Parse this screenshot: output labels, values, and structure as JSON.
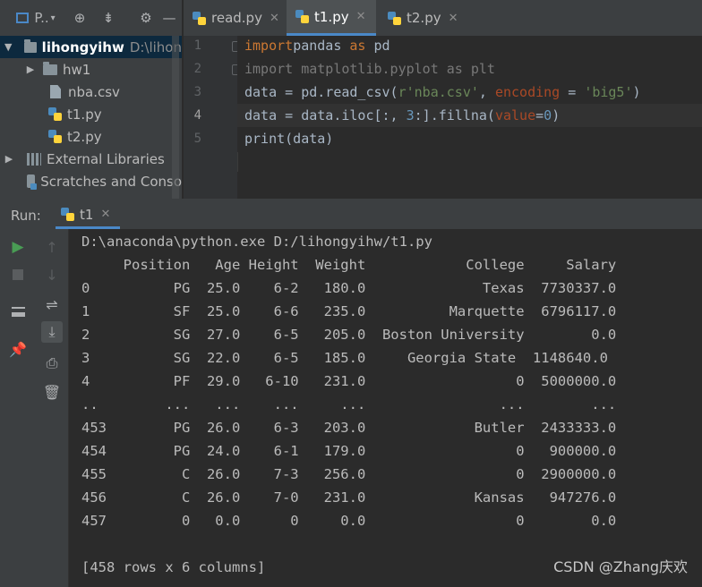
{
  "project_toolbar": {
    "view_label": "P..",
    "icons": [
      "crosshair-icon",
      "collapse-icon",
      "gear-icon",
      "hide-icon"
    ]
  },
  "project_tree": [
    {
      "name": "lihongyihw",
      "path": "D:\\lihon",
      "type": "folder",
      "expanded": true
    },
    {
      "name": "hw1",
      "type": "folder",
      "expanded": false
    },
    {
      "name": "nba.csv",
      "type": "csv"
    },
    {
      "name": "t1.py",
      "type": "py"
    },
    {
      "name": "t2.py",
      "type": "py"
    },
    {
      "name": "External Libraries",
      "type": "lib"
    },
    {
      "name": "Scratches and Conso",
      "type": "scratch"
    }
  ],
  "editor_tabs": [
    {
      "label": "read.py",
      "active": false
    },
    {
      "label": "t1.py",
      "active": true
    },
    {
      "label": "t2.py",
      "active": false
    }
  ],
  "code_lines": [
    {
      "num": "1",
      "tokens": [
        [
          "kw",
          "import"
        ],
        [
          "",
          "pandas "
        ],
        [
          "kw",
          "as"
        ],
        [
          "",
          " pd"
        ]
      ]
    },
    {
      "num": "2",
      "tokens": [
        [
          "dim",
          "import matplotlib.pyplot as plt"
        ]
      ]
    },
    {
      "num": "3",
      "tokens": [
        [
          "",
          "data = pd.read_csv("
        ],
        [
          "str",
          "r'nba.csv'"
        ],
        [
          "",
          ", "
        ],
        [
          "param",
          "encoding"
        ],
        [
          "",
          " = "
        ],
        [
          "str",
          "'big5'"
        ],
        [
          "",
          ")"
        ]
      ]
    },
    {
      "num": "4",
      "tokens": [
        [
          "",
          "data = data.iloc[:, "
        ],
        [
          "num",
          "3"
        ],
        [
          "",
          ":].fillna("
        ],
        [
          "param",
          "value"
        ],
        [
          "",
          "="
        ],
        [
          "num",
          "0"
        ],
        [
          "",
          ")"
        ]
      ]
    },
    {
      "num": "5",
      "tokens": [
        [
          "",
          "print(data)"
        ]
      ]
    }
  ],
  "run_panel": {
    "label": "Run:",
    "tab": "t1",
    "console_lines": [
      "D:\\anaconda\\python.exe D:/lihongyihw/t1.py",
      "     Position   Age Height  Weight            College     Salary",
      "0          PG  25.0    6-2   180.0              Texas  7730337.0",
      "1          SF  25.0    6-6   235.0          Marquette  6796117.0",
      "2          SG  27.0    6-5   205.0  Boston University        0.0",
      "3          SG  22.0    6-5   185.0     Georgia State  1148640.0",
      "4          PF  29.0   6-10   231.0                  0  5000000.0",
      "..        ...   ...    ...     ...                ...        ...",
      "453        PG  26.0    6-3   203.0             Butler  2433333.0",
      "454        PG  24.0    6-1   179.0                  0   900000.0",
      "455         C  26.0    7-3   256.0                  0  2900000.0",
      "456         C  26.0    7-0   231.0             Kansas   947276.0",
      "457         0   0.0      0     0.0                  0        0.0",
      "",
      "[458 rows x 6 columns]"
    ]
  },
  "watermark": "CSDN @Zhang庆欢"
}
